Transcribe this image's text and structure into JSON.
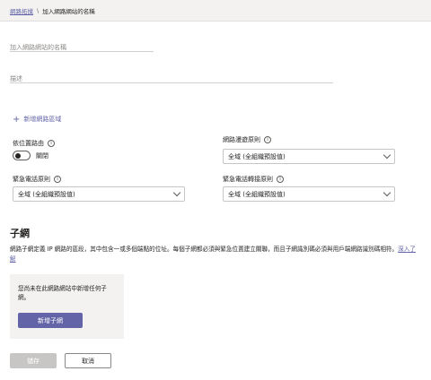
{
  "breadcrumb": {
    "parent": "網路拓撲",
    "separator": "\\",
    "current": "加入網路網站的名稱"
  },
  "form": {
    "name_placeholder": "加入網路網站的名稱",
    "description_placeholder": "描述",
    "add_subnet_range_label": "新增網路區域",
    "location_routing": {
      "label": "依位置路由",
      "toggle_state": "關閉"
    },
    "roaming_policy": {
      "label": "網路漫遊原則",
      "value": "全域 (全組織預設值)"
    },
    "emergency_calling_policy": {
      "label": "緊急電話原則",
      "value": "全域 (全組織預設值)"
    },
    "emergency_call_routing_policy": {
      "label": "緊急電話轉接原則",
      "value": "全域 (全組織預設值)"
    }
  },
  "subnets": {
    "title": "子網",
    "description": "網路子網定義 IP 網路的區段，其中包含一或多個端點的位址。每個子網都必須與緊急位置建立關聯，而且子網識別碼必須與用戶端網路識別碼相符。",
    "learn_more": "深入了解",
    "empty_message": "您尚未在此網路網站中新增任何子網。",
    "add_button": "新增子網"
  },
  "footer": {
    "save": "儲存",
    "cancel": "取消"
  },
  "colors": {
    "accent": "#6264a7",
    "disabled": "#c8c6c4"
  }
}
